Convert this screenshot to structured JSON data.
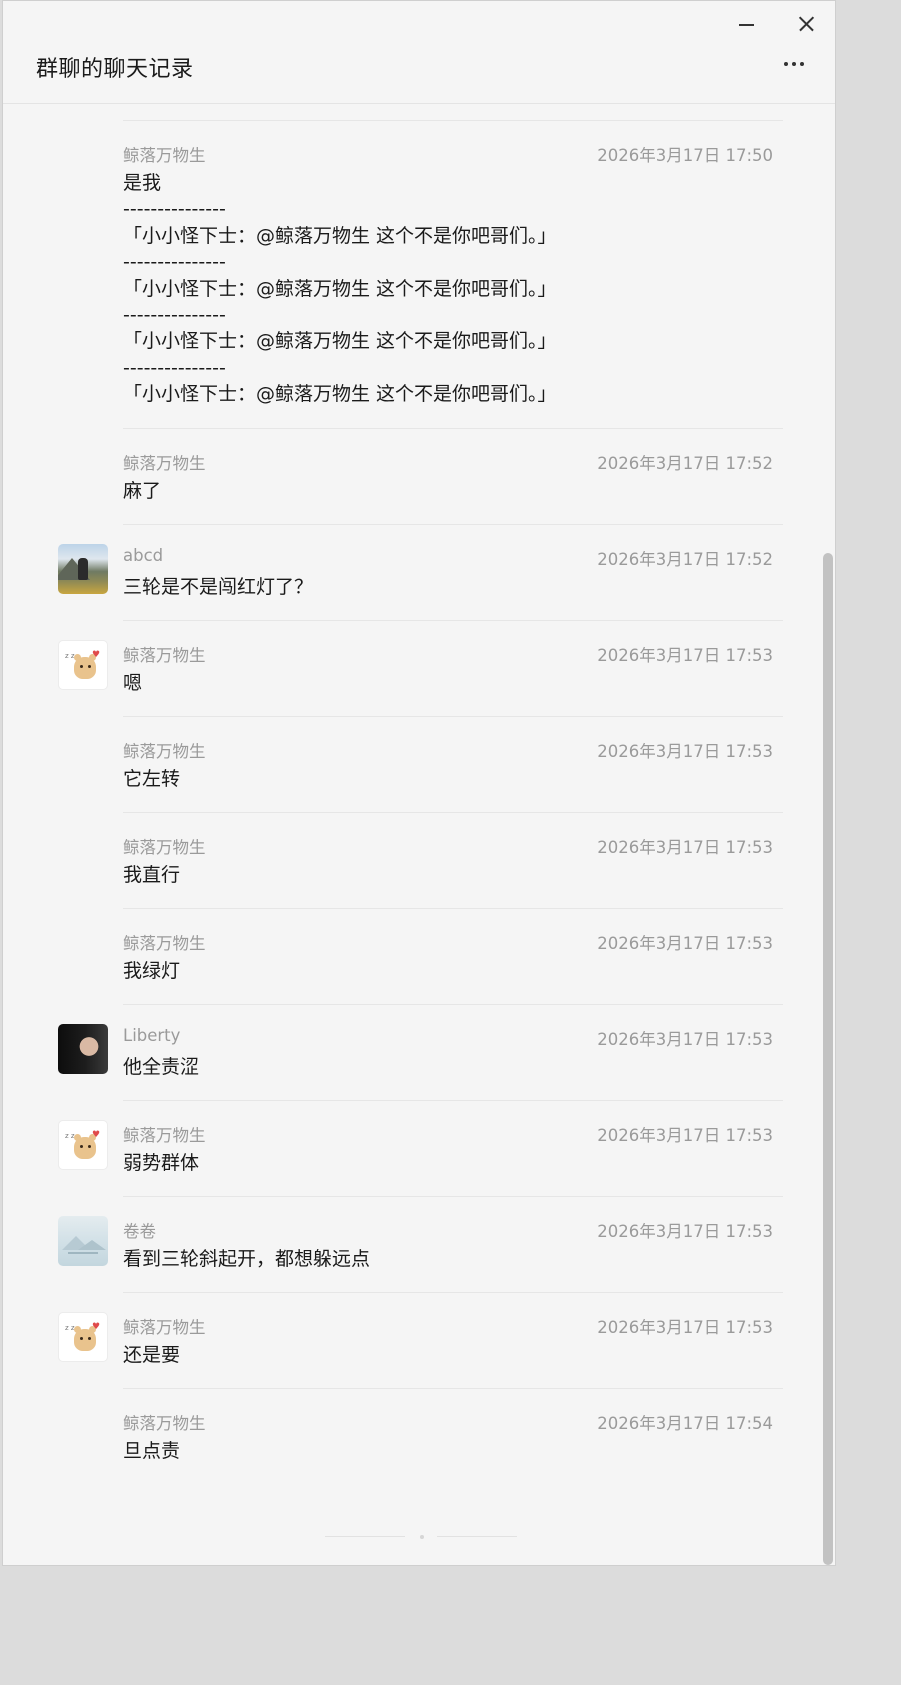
{
  "window": {
    "title": "群聊的聊天记录"
  },
  "messages": [
    {
      "sender": "鲸落万物生",
      "time": "2026年3月17日 17:50",
      "content": "是我\n---------------\n「小小怪下士：@鲸落万物生 这个不是你吧哥们。」\n---------------\n「小小怪下士：@鲸落万物生 这个不是你吧哥们。」\n---------------\n「小小怪下士：@鲸落万物生 这个不是你吧哥们。」\n---------------\n「小小怪下士：@鲸落万物生 这个不是你吧哥们。」",
      "avatar": "none"
    },
    {
      "sender": "鲸落万物生",
      "time": "2026年3月17日 17:52",
      "content": "麻了",
      "avatar": "none"
    },
    {
      "sender": "abcd",
      "time": "2026年3月17日 17:52",
      "content": "三轮是不是闯红灯了？",
      "avatar": "landscape"
    },
    {
      "sender": "鲸落万物生",
      "time": "2026年3月17日 17:53",
      "content": "嗯",
      "avatar": "bear"
    },
    {
      "sender": "鲸落万物生",
      "time": "2026年3月17日 17:53",
      "content": "它左转",
      "avatar": "none"
    },
    {
      "sender": "鲸落万物生",
      "time": "2026年3月17日 17:53",
      "content": "我直行",
      "avatar": "none"
    },
    {
      "sender": "鲸落万物生",
      "time": "2026年3月17日 17:53",
      "content": "我绿灯",
      "avatar": "none"
    },
    {
      "sender": "Liberty",
      "time": "2026年3月17日 17:53",
      "content": "他全责涩",
      "avatar": "girl"
    },
    {
      "sender": "鲸落万物生",
      "time": "2026年3月17日 17:53",
      "content": "弱势群体",
      "avatar": "bear"
    },
    {
      "sender": "卷卷",
      "time": "2026年3月17日 17:53",
      "content": "看到三轮斜起开，都想躲远点",
      "avatar": "misty"
    },
    {
      "sender": "鲸落万物生",
      "time": "2026年3月17日 17:53",
      "content": "还是要",
      "avatar": "bear"
    },
    {
      "sender": "鲸落万物生",
      "time": "2026年3月17日 17:54",
      "content": "旦点责",
      "avatar": "none"
    }
  ],
  "icons": {
    "minimize": "minimize-icon",
    "close": "close-icon",
    "more": "more-options-icon"
  },
  "colors": {
    "window_bg": "#f5f5f5",
    "meta_text": "#9a9a9a",
    "body_text": "#1a1a1a"
  }
}
